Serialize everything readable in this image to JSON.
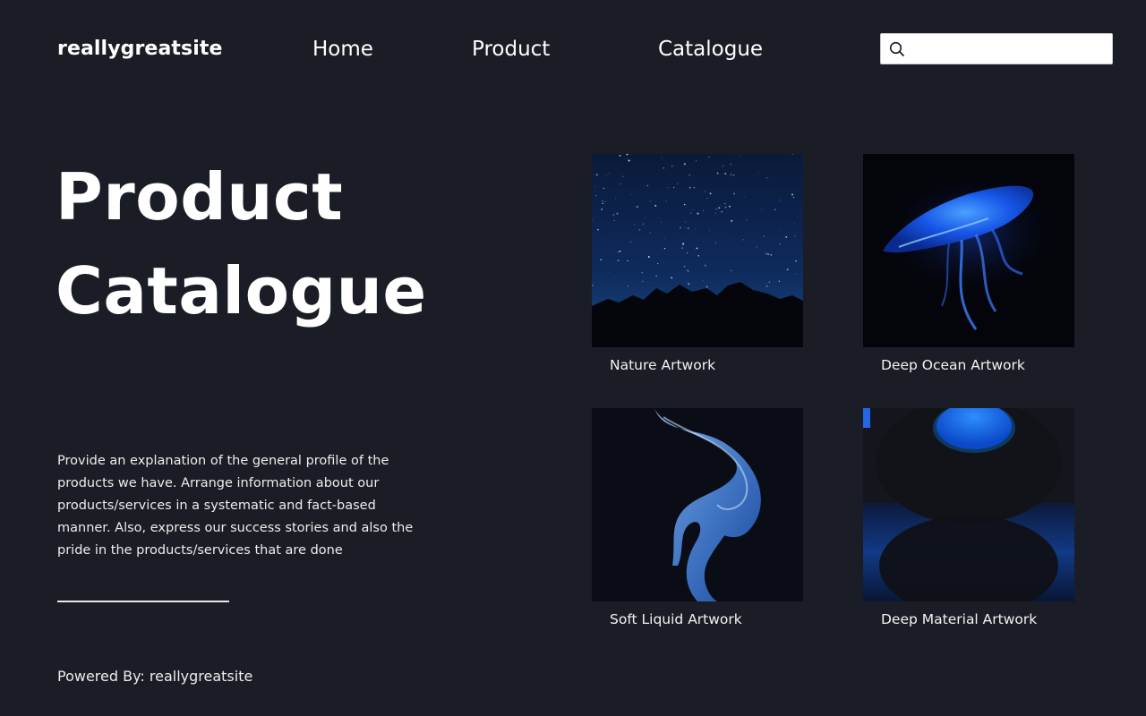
{
  "header": {
    "logo": "reallygreatsite",
    "nav": [
      {
        "label": "Home"
      },
      {
        "label": "Product"
      },
      {
        "label": "Catalogue"
      }
    ],
    "search": {
      "placeholder": "",
      "value": "",
      "icon": "search-icon"
    }
  },
  "hero": {
    "title_line1": "Product",
    "title_line2": "Catalogue",
    "description": "Provide an explanation of the general profile of the products we have. Arrange information about our products/services in a systematic and fact-based manner. Also, express our success stories and also the pride in the products/services that are done"
  },
  "products": [
    {
      "label": "Nature Artwork",
      "image": "starry-night-mountains"
    },
    {
      "label": "Deep Ocean Artwork",
      "image": "glowing-jellyfish"
    },
    {
      "label": "Soft Liquid Artwork",
      "image": "blue-smoke"
    },
    {
      "label": "Deep Material Artwork",
      "image": "blue-circle-reflection"
    }
  ],
  "footer": {
    "text": "Powered By: reallygreatsite"
  },
  "colors": {
    "background": "#1a1d25",
    "text": "#ffffff",
    "accent_blue": "#1e6cff"
  }
}
